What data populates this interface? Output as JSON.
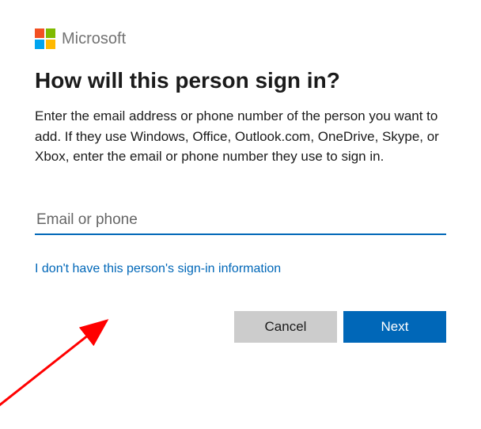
{
  "brand": "Microsoft",
  "heading": "How will this person sign in?",
  "description": "Enter the email address or phone number of the person you want to add. If they use Windows, Office, Outlook.com, OneDrive, Skype, or Xbox, enter the email or phone number they use to sign in.",
  "input": {
    "placeholder": "Email or phone",
    "value": ""
  },
  "link_text": "I don't have this person's sign-in information",
  "buttons": {
    "cancel": "Cancel",
    "next": "Next"
  },
  "colors": {
    "accent": "#0067b8"
  }
}
